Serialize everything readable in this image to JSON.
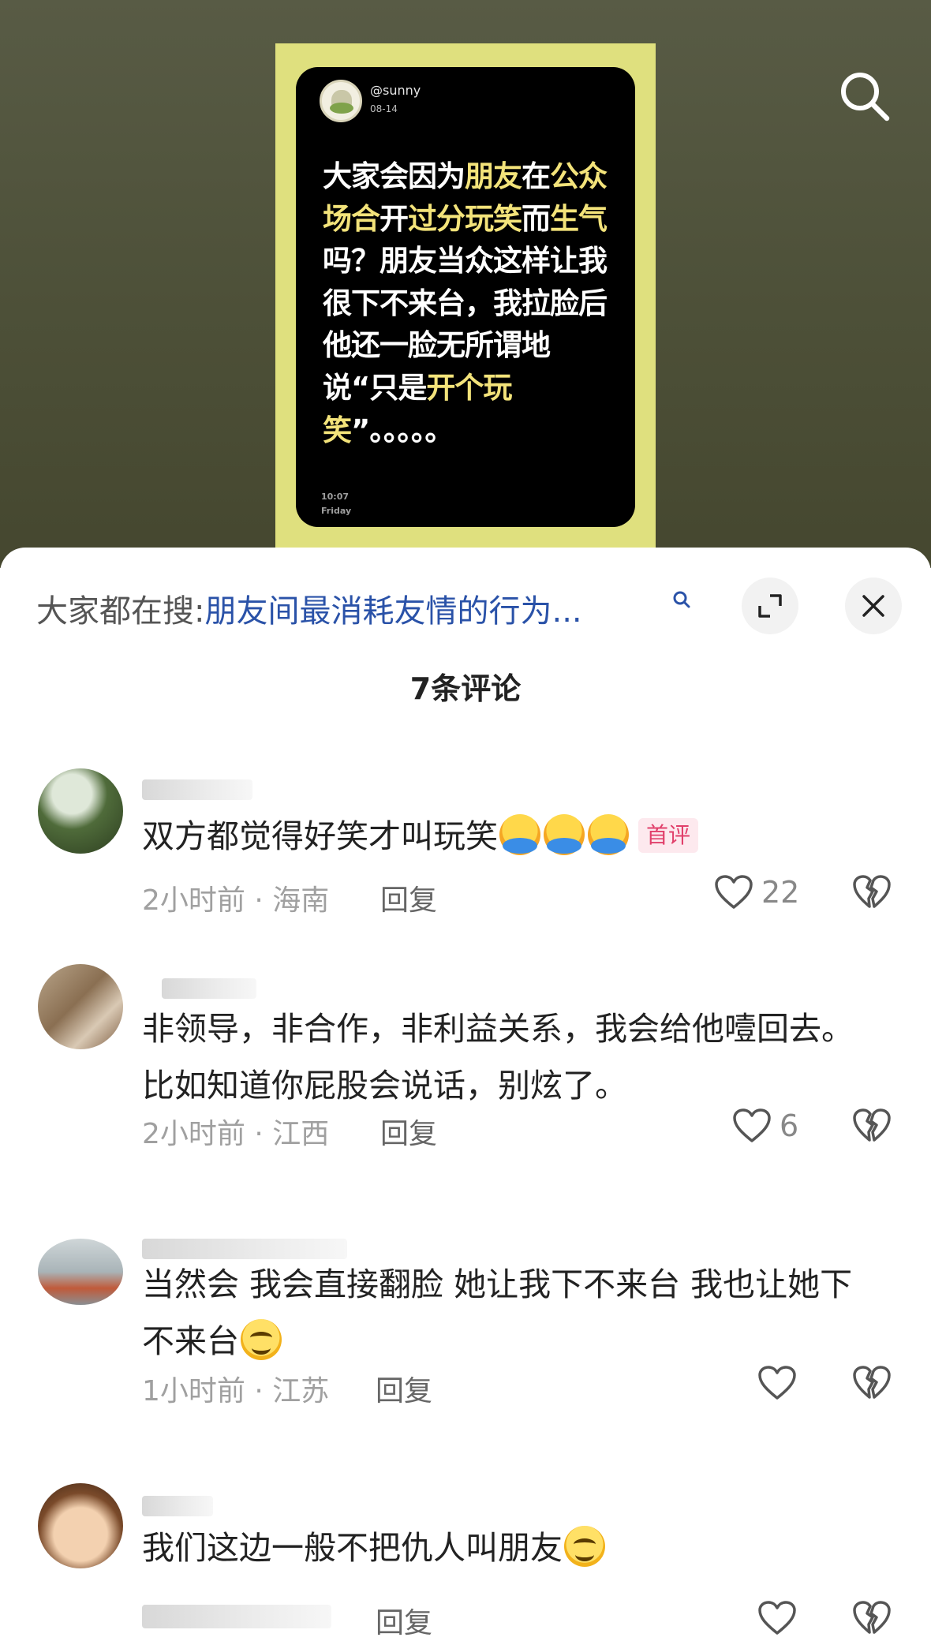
{
  "post": {
    "handle": "@sunny",
    "date": "08-14",
    "text_parts": [
      {
        "t": "大家会因为",
        "hl": false
      },
      {
        "t": "朋友",
        "hl": true
      },
      {
        "t": "在",
        "hl": false
      },
      {
        "t": "公众场合",
        "hl": true
      },
      {
        "t": "开",
        "hl": false
      },
      {
        "t": "过分玩笑",
        "hl": true
      },
      {
        "t": "而",
        "hl": false
      },
      {
        "t": "生气",
        "hl": true
      },
      {
        "t": "吗？朋友当众这样让我很下不来台，我拉脸后他还一脸无所谓地说“只是",
        "hl": false
      },
      {
        "t": "开个玩笑",
        "hl": true
      },
      {
        "t": "”。。。。。",
        "hl": false
      }
    ],
    "time": "10:07",
    "day": "Friday",
    "highlight_color": "#f3e37a",
    "poster_bg": "#dfe07e"
  },
  "panel": {
    "search_prefix": "大家都在搜:",
    "search_link": "朋友间最消耗友情的行为...",
    "comment_count_title": "7条评论"
  },
  "comments": [
    {
      "text": "双方都觉得好笑才叫玩笑",
      "emojis": [
        "hug",
        "hug",
        "hug"
      ],
      "badge": "首评",
      "meta": "2小时前 · 海南",
      "reply": "回复",
      "likes": "22"
    },
    {
      "text": "非领导，非合作，非利益关系，我会给他噎回去。比如知道你屁股会说话，别炫了。",
      "meta": "2小时前 · 江西",
      "reply": "回复",
      "likes": "6"
    },
    {
      "text": "当然会 我会直接翻脸 她让我下不来台 我也让她下不来台",
      "emojis": [
        "smile"
      ],
      "meta": "1小时前 · 江苏",
      "reply": "回复",
      "likes": ""
    },
    {
      "text": "我们这边一般不把仇人叫朋友",
      "emojis": [
        "smile"
      ],
      "meta": "",
      "reply": "回复",
      "likes": ""
    }
  ],
  "icons": {
    "top_search": "search-icon",
    "hint_search": "search-icon",
    "expand": "expand-icon",
    "close": "close-icon",
    "like": "heart-icon",
    "dislike": "broken-heart-icon"
  }
}
